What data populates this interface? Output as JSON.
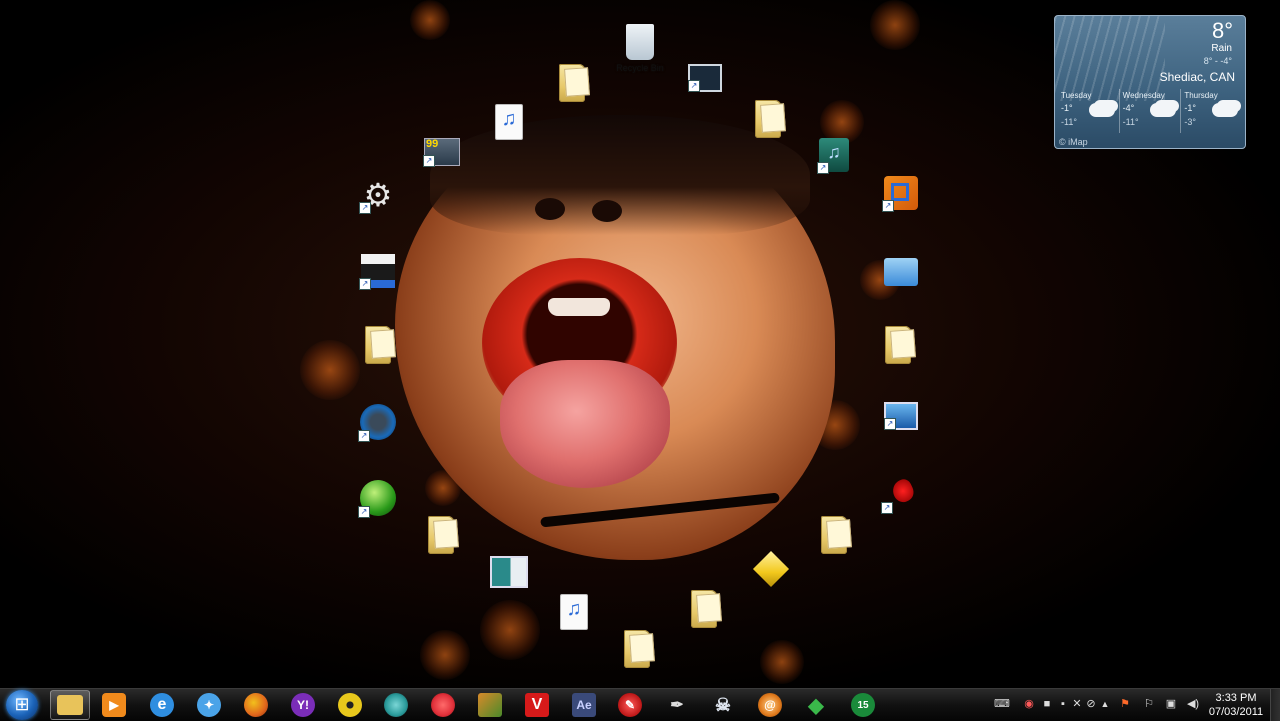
{
  "desktop": {
    "icons": [
      {
        "id": "recycle-bin",
        "label": "Recycle Bin",
        "kind": "recycle"
      },
      {
        "id": "folder-top-left",
        "label": "",
        "kind": "folder"
      },
      {
        "id": "computer",
        "label": "",
        "kind": "computer"
      },
      {
        "id": "mp3-1",
        "label": "",
        "kind": "mp3"
      },
      {
        "id": "folder-top-right",
        "label": "",
        "kind": "folder"
      },
      {
        "id": "winamp-99",
        "label": "",
        "kind": "app"
      },
      {
        "id": "audio-tool",
        "label": "",
        "kind": "app"
      },
      {
        "id": "settings-gear",
        "label": "",
        "kind": "app"
      },
      {
        "id": "virtualbox",
        "label": "",
        "kind": "app"
      },
      {
        "id": "video-editor",
        "label": "",
        "kind": "app"
      },
      {
        "id": "control-panel",
        "label": "",
        "kind": "app"
      },
      {
        "id": "folder-left",
        "label": "",
        "kind": "folder"
      },
      {
        "id": "folder-right",
        "label": "",
        "kind": "folder"
      },
      {
        "id": "webcam",
        "label": "",
        "kind": "app"
      },
      {
        "id": "network-computer",
        "label": "",
        "kind": "app"
      },
      {
        "id": "green-ball",
        "label": "",
        "kind": "app"
      },
      {
        "id": "red-app",
        "label": "",
        "kind": "app"
      },
      {
        "id": "folder-bottom-left",
        "label": "",
        "kind": "folder"
      },
      {
        "id": "folder-bottom-right",
        "label": "",
        "kind": "folder"
      },
      {
        "id": "picture-file",
        "label": "",
        "kind": "file"
      },
      {
        "id": "yellow-cube",
        "label": "",
        "kind": "app"
      },
      {
        "id": "mp3-2",
        "label": "",
        "kind": "mp3"
      },
      {
        "id": "folder-bottom-center",
        "label": "",
        "kind": "folder"
      },
      {
        "id": "folder-bottom",
        "label": "",
        "kind": "folder"
      }
    ]
  },
  "weather": {
    "temperature": "8°",
    "condition": "Rain",
    "range": "8° - -4°",
    "city": "Shediac, CAN",
    "days": [
      {
        "name": "Tuesday",
        "hi": "-1°",
        "lo": "-11°"
      },
      {
        "name": "Wednesday",
        "hi": "-4°",
        "lo": "-11°"
      },
      {
        "name": "Thursday",
        "hi": "-1°",
        "lo": "-3°"
      }
    ],
    "source": "© iMap"
  },
  "taskbar": {
    "buttons": [
      {
        "id": "explorer",
        "label": "",
        "icon": "folder-icon",
        "color": "#e8c35a",
        "active": true
      },
      {
        "id": "media-player",
        "label": "",
        "icon": "media-player-icon",
        "color": "#f08a1c"
      },
      {
        "id": "internet-explorer",
        "label": "",
        "icon": "ie-icon",
        "color": "#2f8ee0"
      },
      {
        "id": "safari",
        "label": "",
        "icon": "compass-icon",
        "color": "#4aa3e8"
      },
      {
        "id": "firefox",
        "label": "",
        "icon": "firefox-icon",
        "color": "#e0661c"
      },
      {
        "id": "yahoo-messenger",
        "label": "Y!",
        "icon": "yahoo-icon",
        "color": "#7a2db8"
      },
      {
        "id": "cd-burner",
        "label": "",
        "icon": "disc-icon",
        "color": "#e8c81c"
      },
      {
        "id": "globe-app",
        "label": "",
        "icon": "globe-icon",
        "color": "#2a9a9a"
      },
      {
        "id": "red-app",
        "label": "",
        "icon": "red-circle-icon",
        "color": "#e0303a"
      },
      {
        "id": "game-app",
        "label": "",
        "icon": "game-icon",
        "color": "#7a5a2a"
      },
      {
        "id": "vegas",
        "label": "V",
        "icon": "vegas-icon",
        "color": "#d61a1a"
      },
      {
        "id": "after-effects",
        "label": "Ae",
        "icon": "after-effects-icon",
        "color": "#3a4a7a"
      },
      {
        "id": "red-tool",
        "label": "",
        "icon": "tool-icon",
        "color": "#c01a1a"
      },
      {
        "id": "pen-app",
        "label": "",
        "icon": "pen-icon",
        "color": "#555555"
      },
      {
        "id": "skull-app",
        "label": "",
        "icon": "skull-icon",
        "color": "#8aa0c0"
      },
      {
        "id": "orange-app",
        "label": "",
        "icon": "spiral-icon",
        "color": "#e07a1c"
      },
      {
        "id": "sims",
        "label": "",
        "icon": "plumbob-icon",
        "color": "#3ab84a"
      },
      {
        "id": "badge-app",
        "label": "15",
        "icon": "badge-icon",
        "color": "#1a8a3a"
      }
    ]
  },
  "tray": {
    "icons": [
      "keyboard-icon",
      "record-icon",
      "tray-app-1",
      "tray-app-2",
      "tray-app-3",
      "tray-app-4",
      "chevron-up-icon",
      "flag-alert-icon",
      "flag-icon",
      "network-icon",
      "volume-icon"
    ]
  },
  "clock": {
    "time": "3:33 PM",
    "date": "07/03/2011"
  }
}
